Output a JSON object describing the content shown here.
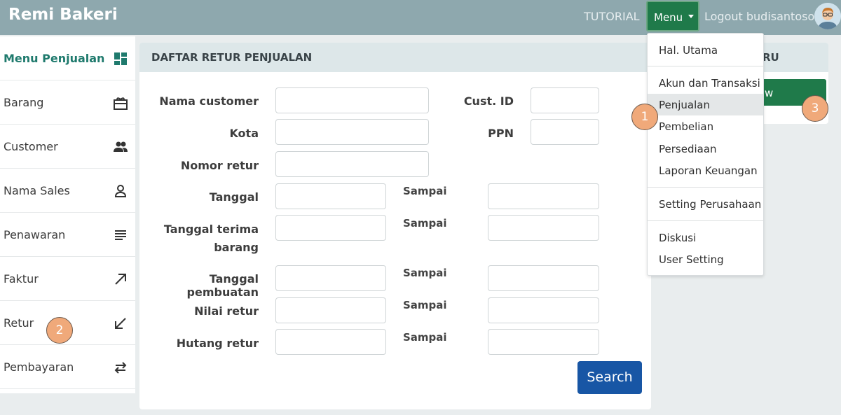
{
  "header": {
    "brand": "Remi Bakeri",
    "tutorial": "TUTORIAL",
    "menu_label": "Menu",
    "logout": "Logout budisantoso"
  },
  "sidebar": {
    "items": [
      {
        "label": "Menu Penjualan",
        "icon": "dashboard-icon"
      },
      {
        "label": "Barang",
        "icon": "gift-box-icon"
      },
      {
        "label": "Customer",
        "icon": "people-icon"
      },
      {
        "label": "Nama Sales",
        "icon": "person-icon"
      },
      {
        "label": "Penawaran",
        "icon": "lines-icon"
      },
      {
        "label": "Faktur",
        "icon": "arrow-up-right-icon"
      },
      {
        "label": "Retur",
        "icon": "arrow-down-left-icon"
      },
      {
        "label": "Pembayaran",
        "icon": "swap-arrows-icon"
      }
    ]
  },
  "main": {
    "title": "DAFTAR RETUR PENJUALAN",
    "fields": {
      "nama_customer": "Nama customer",
      "cust_id": "Cust. ID",
      "kota": "Kota",
      "ppn": "PPN",
      "nomor_retur": "Nomor retur",
      "tanggal": "Tanggal",
      "tanggal_terima_1": "Tanggal terima",
      "tanggal_terima_2": "barang",
      "tanggal_pembuatan": "Tanggal pembuatan",
      "nilai_retur": "Nilai retur",
      "hutang_retur": "Hutang retur",
      "sampai": "Sampai"
    },
    "search_label": "Search"
  },
  "right_panel": {
    "title_fragment": "RU",
    "button_fragment": "w"
  },
  "dropdown": {
    "items": [
      "Hal. Utama",
      "Akun dan Transaksi",
      "Penjualan",
      "Pembelian",
      "Persediaan",
      "Laporan Keuangan",
      "Setting Perusahaan",
      "Diskusi",
      "User Setting"
    ],
    "highlighted": "Penjualan"
  },
  "badges": [
    "1",
    "2",
    "3"
  ],
  "colors": {
    "topbar": "#8ea8ae",
    "primary_green": "#1f7a4a",
    "search_blue": "#1856a5",
    "badge": "#f0a97a"
  }
}
